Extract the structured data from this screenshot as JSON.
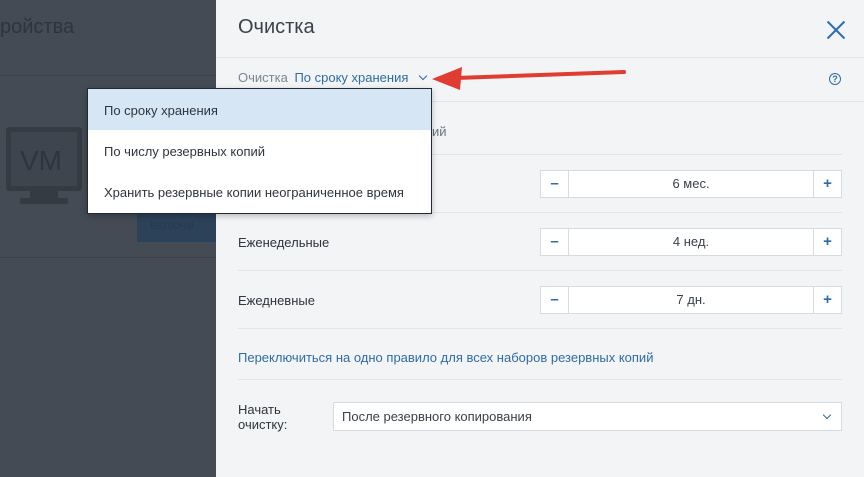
{
  "background": {
    "title_fragment": "ройства",
    "monitor_label": "VM",
    "button_fragment": "включи"
  },
  "panel": {
    "title": "Очистка",
    "subheader": {
      "label": "Очистка",
      "value": "По сроку хранения"
    },
    "partial_text": "ий",
    "rows": [
      {
        "label": "",
        "value": "6 мес.",
        "minus": "–",
        "plus": "+"
      },
      {
        "label": "Еженедельные",
        "value": "4 нед.",
        "minus": "–",
        "plus": "+"
      },
      {
        "label": "Ежедневные",
        "value": "7 дн.",
        "minus": "–",
        "plus": "+"
      }
    ],
    "switch_link": "Переключиться на одно правило для всех наборов резервных копий",
    "start": {
      "label_line1": "Начать",
      "label_line2": "очистку:",
      "selected": "После резервного копирования"
    }
  },
  "dropdown": {
    "items": [
      {
        "label": "По сроку хранения",
        "selected": true
      },
      {
        "label": "По числу резервных копий",
        "selected": false
      },
      {
        "label": "Хранить резервные копии неограниченное время",
        "selected": false
      }
    ]
  },
  "colors": {
    "accent": "#2e6ca5",
    "annotation_arrow": "#e03c31",
    "selected_item_bg": "#d6e6f5"
  },
  "icons": [
    "close-icon",
    "chevron-down-icon",
    "help-icon",
    "minus-icon",
    "plus-icon",
    "monitor-icon",
    "arrow-annotation-icon"
  ]
}
